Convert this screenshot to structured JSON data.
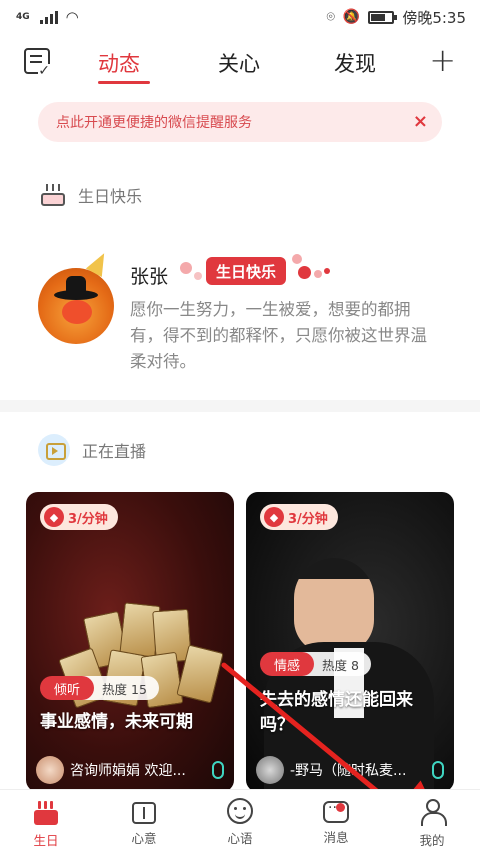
{
  "status_bar": {
    "network": "4G",
    "time_label": "傍晚5:35"
  },
  "header": {
    "tabs": [
      "动态",
      "关心",
      "发现"
    ],
    "active_tab": "动态"
  },
  "notice": {
    "text": "点此开通更便捷的微信提醒服务",
    "close": "×"
  },
  "birthday": {
    "section_title": "生日快乐",
    "name": "张张",
    "badge": "生日快乐",
    "wish": "愿你一生努力，一生被爱，想要的都拥有，得不到的都释怀，只愿你被这世界温柔对待。"
  },
  "live": {
    "section_title": "正在直播",
    "cards": [
      {
        "price": "3/分钟",
        "tag": "倾听",
        "heat": "热度 15",
        "title": "事业感情，未来可期",
        "host": "咨询师娟娟 欢迎..."
      },
      {
        "price": "3/分钟",
        "tag": "情感",
        "heat": "热度 8",
        "title": "失去的感情还能回来吗？",
        "host": "-野马（随时私麦..."
      }
    ]
  },
  "tabbar": {
    "items": [
      "生日",
      "心意",
      "心语",
      "消息",
      "我的"
    ],
    "active": "生日"
  },
  "colors": {
    "accent": "#e0383e",
    "annotation_arrow": "#e5231f"
  }
}
